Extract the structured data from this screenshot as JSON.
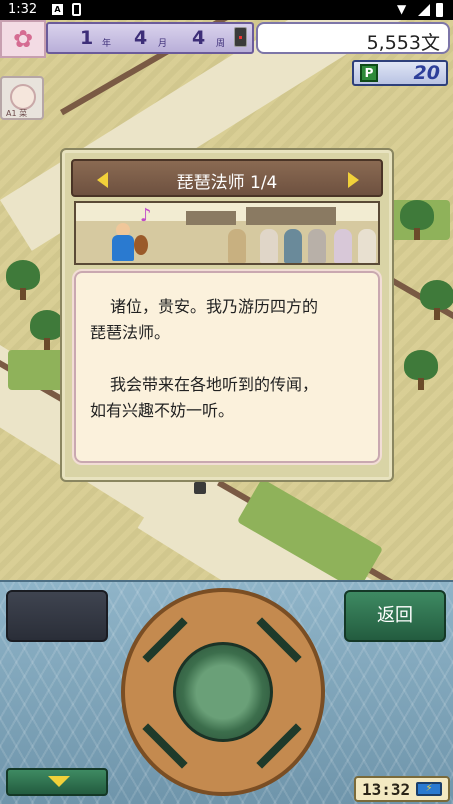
{
  "status_bar": {
    "time": "1:32",
    "notification_icon": "A"
  },
  "hud": {
    "year_value": "1",
    "year_unit": "年",
    "month_value": "4",
    "month_unit": "月",
    "week_value": "4",
    "week_unit": "周",
    "money": "5,553文",
    "points_badge": "P",
    "points_value": "20",
    "avatar_label": "A1 菜"
  },
  "dialog": {
    "title": "琵琶法师 1/4",
    "lines": [
      "诸位，贵安。我乃游历四方的",
      "琵琶法师。",
      "",
      "我会带来在各地听到的传闻，",
      "如有兴趣不妨一听。"
    ]
  },
  "controls": {
    "back_label": "返回",
    "clock_time": "13:32",
    "battery_icon": "⚡"
  },
  "icons": {
    "sakura": "sakura-icon",
    "music_note": "♪",
    "wifi": "▼"
  },
  "colors": {
    "dialog_bg": "#d9d4a6",
    "header_bg": "#6e5140",
    "accent_arrow": "#f1d13a",
    "controller_bg": "#8fb4c8",
    "back_button": "#3e8a62"
  }
}
